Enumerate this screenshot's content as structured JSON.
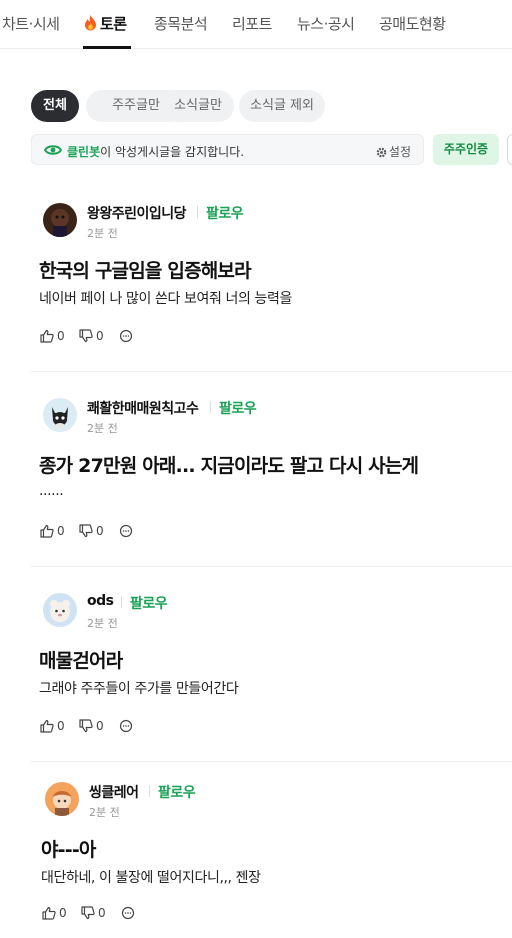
{
  "tabs": [
    {
      "label": "차트·시세"
    },
    {
      "label": "토론",
      "active": true
    },
    {
      "label": "종목분석"
    },
    {
      "label": "리포트"
    },
    {
      "label": "뉴스·공시"
    },
    {
      "label": "공매도현황"
    }
  ],
  "filters": [
    {
      "label": "전체",
      "active": true
    },
    {
      "label": "주주글만"
    },
    {
      "label": "소식글만"
    },
    {
      "label": "소식글 제외"
    }
  ],
  "cleanbot": {
    "brand": "클린봇",
    "message": "이 악성게시글을 감지합니다.",
    "settings_label": "설정"
  },
  "shareholder_verify_label": "주주인증",
  "colors": {
    "accent_green": "#1aa255",
    "active_chip": "#2b2d31"
  },
  "posts": [
    {
      "author": "왕왕주린이입니당",
      "follow_label": "팔로우",
      "time": "2분 전",
      "title": "한국의 구글임을 입증해보라",
      "body": "네이버 페이 나 많이 쓴다 보여줘 너의 능력을",
      "likes": "0",
      "dislikes": "0",
      "avatar_icon": "dark-character-avatar"
    },
    {
      "author": "쾌활한매매원칙고수",
      "follow_label": "팔로우",
      "time": "2분 전",
      "title": "종가 27만원 아래... 지금이라도 팔고 다시 사는게",
      "body": "......",
      "likes": "0",
      "dislikes": "0",
      "avatar_icon": "black-cat-avatar"
    },
    {
      "author": "ods",
      "follow_label": "팔로우",
      "time": "2분 전",
      "title": "매물걷어라",
      "body": "그래야 주주들이 주가를 만들어간다",
      "likes": "0",
      "dislikes": "0",
      "avatar_icon": "white-bear-avatar"
    },
    {
      "author": "씽클레어",
      "follow_label": "팔로우",
      "time": "2분 전",
      "title": "야---아",
      "body": "대단하네, 이 불장에 떨어지다니,,, 젠장",
      "likes": "0",
      "dislikes": "0",
      "avatar_icon": "orange-character-avatar"
    }
  ]
}
